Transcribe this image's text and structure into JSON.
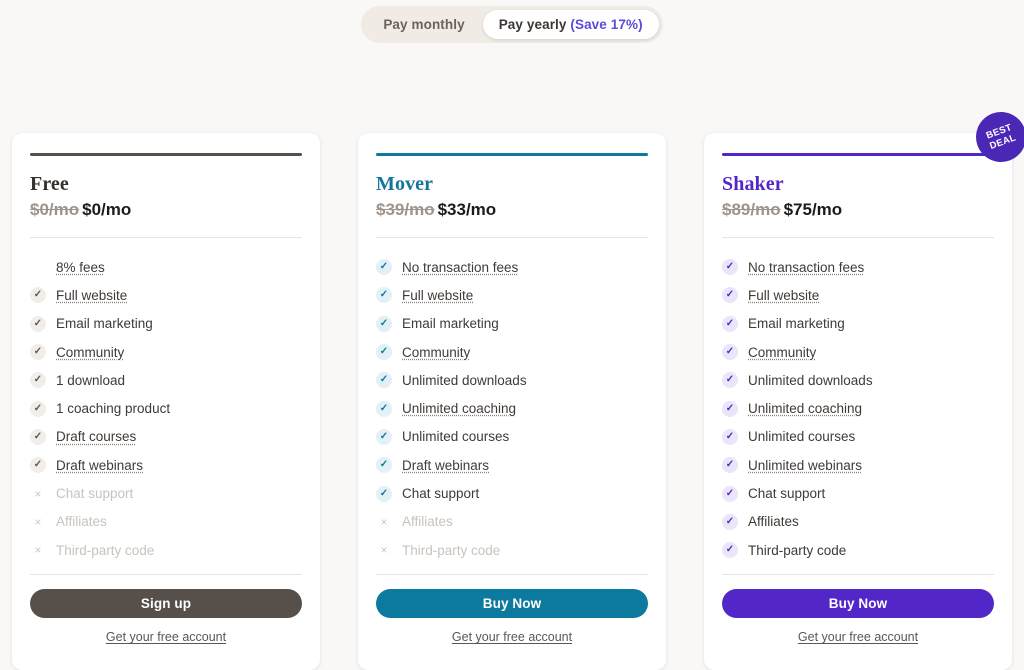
{
  "billing_toggle": {
    "monthly_label": "Pay monthly",
    "yearly_label": "Pay yearly",
    "yearly_save_label": "(Save 17%)",
    "active": "yearly",
    "save_color": "#5b4bdb",
    "track_color": "#f0ebe5"
  },
  "badge": {
    "line1": "BEST",
    "line2": "DEAL",
    "color": "#4a27b5"
  },
  "plans": [
    {
      "name": "Free",
      "accent": "#57504a",
      "name_color": "#35302c",
      "price_old": "$0/mo",
      "price_new": "$0/mo",
      "cta_label": "Sign up",
      "cta_color": "#57504a",
      "sub_link": "Get your free account",
      "check_bg": "#f1ede9",
      "check_color": "#5d564f",
      "features": [
        {
          "label": "8% fees",
          "included": true,
          "tooltip": true,
          "no_mark": true
        },
        {
          "label": "Full website",
          "included": true,
          "tooltip": true
        },
        {
          "label": "Email marketing",
          "included": true,
          "tooltip": false
        },
        {
          "label": "Community",
          "included": true,
          "tooltip": true
        },
        {
          "label": "1 download",
          "included": true,
          "tooltip": false
        },
        {
          "label": "1 coaching product",
          "included": true,
          "tooltip": false
        },
        {
          "label": "Draft courses",
          "included": true,
          "tooltip": true
        },
        {
          "label": "Draft webinars",
          "included": true,
          "tooltip": true
        },
        {
          "label": "Chat support",
          "included": false,
          "tooltip": false
        },
        {
          "label": "Affiliates",
          "included": false,
          "tooltip": false
        },
        {
          "label": "Third-party code",
          "included": false,
          "tooltip": false
        }
      ]
    },
    {
      "name": "Mover",
      "accent": "#0b7a9e",
      "name_color": "#15769b",
      "price_old": "$39/mo",
      "price_new": "$33/mo",
      "cta_label": "Buy Now",
      "cta_color": "#0b7a9e",
      "sub_link": "Get your free account",
      "check_bg": "#e3f0f5",
      "check_color": "#0b7a9e",
      "features": [
        {
          "label": "No transaction fees",
          "included": true,
          "tooltip": true
        },
        {
          "label": "Full website",
          "included": true,
          "tooltip": true
        },
        {
          "label": "Email marketing",
          "included": true,
          "tooltip": false
        },
        {
          "label": "Community",
          "included": true,
          "tooltip": true
        },
        {
          "label": "Unlimited downloads",
          "included": true,
          "tooltip": false
        },
        {
          "label": "Unlimited coaching",
          "included": true,
          "tooltip": true
        },
        {
          "label": "Unlimited courses",
          "included": true,
          "tooltip": false
        },
        {
          "label": "Draft webinars",
          "included": true,
          "tooltip": true
        },
        {
          "label": "Chat support",
          "included": true,
          "tooltip": false
        },
        {
          "label": "Affiliates",
          "included": false,
          "tooltip": false
        },
        {
          "label": "Third-party code",
          "included": false,
          "tooltip": false
        }
      ]
    },
    {
      "name": "Shaker",
      "accent": "#5326c8",
      "name_color": "#5326c8",
      "price_old": "$89/mo",
      "price_new": "$75/mo",
      "cta_label": "Buy Now",
      "cta_color": "#5326c8",
      "sub_link": "Get your free account",
      "check_bg": "#eae5f8",
      "check_color": "#5326c8",
      "features": [
        {
          "label": "No transaction fees",
          "included": true,
          "tooltip": true
        },
        {
          "label": "Full website",
          "included": true,
          "tooltip": true
        },
        {
          "label": "Email marketing",
          "included": true,
          "tooltip": false
        },
        {
          "label": "Community",
          "included": true,
          "tooltip": true
        },
        {
          "label": "Unlimited downloads",
          "included": true,
          "tooltip": false
        },
        {
          "label": "Unlimited coaching",
          "included": true,
          "tooltip": true
        },
        {
          "label": "Unlimited courses",
          "included": true,
          "tooltip": false
        },
        {
          "label": "Unlimited webinars",
          "included": true,
          "tooltip": true
        },
        {
          "label": "Chat support",
          "included": true,
          "tooltip": false
        },
        {
          "label": "Affiliates",
          "included": true,
          "tooltip": false
        },
        {
          "label": "Third-party code",
          "included": true,
          "tooltip": false
        }
      ]
    }
  ],
  "icons": {
    "check": "✓",
    "cross": "×"
  }
}
